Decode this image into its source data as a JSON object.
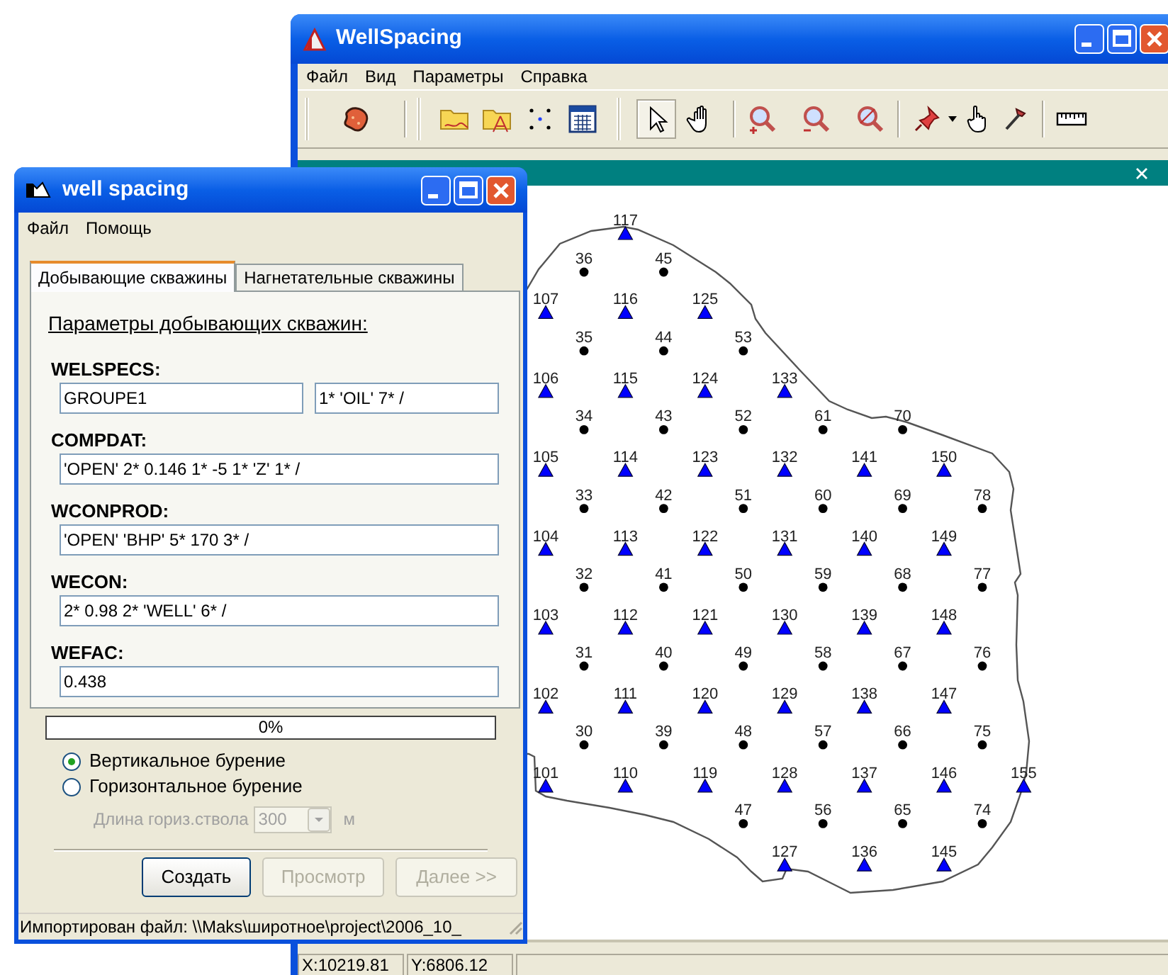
{
  "main_window": {
    "title": "WellSpacing",
    "menu": [
      "Файл",
      "Вид",
      "Параметры",
      "Справка"
    ],
    "tool_modes": [
      {
        "selected": true
      },
      {
        "selected": false
      }
    ],
    "well_rows": [
      {
        "kind": "triangle",
        "wells": [
          "117"
        ]
      },
      {
        "kind": "dot",
        "wells": [
          "36",
          "45"
        ]
      },
      {
        "kind": "triangle",
        "wells": [
          "107",
          "116",
          "125"
        ]
      },
      {
        "kind": "dot",
        "wells": [
          "35",
          "44",
          "53"
        ]
      },
      {
        "kind": "triangle",
        "wells": [
          "106",
          "115",
          "124",
          "133"
        ]
      },
      {
        "kind": "dot",
        "wells": [
          "34",
          "43",
          "52",
          "61",
          "70"
        ]
      },
      {
        "kind": "triangle",
        "wells": [
          "105",
          "114",
          "123",
          "132",
          "141",
          "150"
        ]
      },
      {
        "kind": "dot",
        "wells": [
          "33",
          "42",
          "51",
          "60",
          "69",
          "78"
        ]
      },
      {
        "kind": "triangle",
        "wells": [
          "104",
          "113",
          "122",
          "131",
          "140",
          "149"
        ]
      },
      {
        "kind": "dot",
        "wells": [
          "32",
          "41",
          "50",
          "59",
          "68",
          "77"
        ]
      },
      {
        "kind": "triangle",
        "wells": [
          "103",
          "112",
          "121",
          "130",
          "139",
          "148"
        ]
      },
      {
        "kind": "dot",
        "wells": [
          "31",
          "40",
          "49",
          "58",
          "67",
          "76"
        ]
      },
      {
        "kind": "triangle",
        "wells": [
          "102",
          "111",
          "120",
          "129",
          "138",
          "147"
        ]
      },
      {
        "kind": "dot",
        "wells": [
          "30",
          "39",
          "48",
          "57",
          "66",
          "75"
        ]
      },
      {
        "kind": "triangle",
        "wells": [
          "101",
          "110",
          "119",
          "128",
          "137",
          "146",
          "155"
        ]
      },
      {
        "kind": "dot",
        "wells": [
          "47",
          "56",
          "65",
          "74"
        ]
      },
      {
        "kind": "triangle",
        "wells": [
          "127",
          "136",
          "145"
        ]
      }
    ],
    "status_bar": [
      "X:10219.81",
      "Y:6806.12"
    ]
  },
  "dialog": {
    "title": "well spacing",
    "menu": [
      "Файл",
      "Помощь"
    ],
    "tabs": [
      {
        "label": "Добывающие скважины",
        "selected": true
      },
      {
        "label": "Нагнетательные скважины",
        "selected": false
      }
    ],
    "heading": "Параметры добывающих скважин:",
    "sections": [
      {
        "label": "WELSPECS:",
        "fields": [
          "GROUPE1",
          "1* 'OIL' 7* /"
        ]
      },
      {
        "label": "COMPDAT:",
        "fields": [
          "'OPEN' 2* 0.146 1* -5 1* 'Z' 1* /"
        ]
      },
      {
        "label": "WCONPROD:",
        "fields": [
          "'OPEN' 'BHP' 5* 170 3* /"
        ]
      },
      {
        "label": "WECON:",
        "fields": [
          "2* 0.98 2* 'WELL' 6* /"
        ]
      },
      {
        "label": "WEFAC:",
        "fields": [
          "0.438"
        ]
      }
    ],
    "progress": {
      "level": 0,
      "text": "0%"
    },
    "radios": [
      {
        "label": "Вертикальное бурение",
        "selected": true
      },
      {
        "label": "Горизонтальное бурение",
        "selected": false
      }
    ],
    "length": {
      "label": "Длина гориз.ствола",
      "value": "300",
      "unit": "м",
      "disabled": true
    },
    "buttons": [
      {
        "label": "Создать",
        "disabled": false
      },
      {
        "label": "Просмотр",
        "disabled": true
      },
      {
        "label": "Далее >>",
        "disabled": true
      }
    ],
    "status": "Импортирован файл: \\\\Maks\\широтное\\project\\2006_10_"
  }
}
